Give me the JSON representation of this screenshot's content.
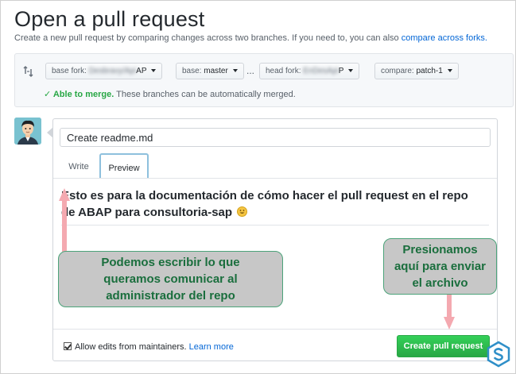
{
  "page": {
    "title": "Open a pull request",
    "subtitle": "Create a new pull request by comparing changes across two branches. If you need to, you can also",
    "compare_forks_link": "compare across forks."
  },
  "compare": {
    "base_fork_prefix": "base fork:",
    "base_fork_hidden": "Desbravy/Api",
    "base_fork_suffix": "AP",
    "base_prefix": "base:",
    "base_value": "master",
    "ellipsis": "...",
    "head_fork_prefix": "head fork:",
    "head_fork_hidden": "EnDesApi",
    "head_fork_suffix": "P",
    "compare_prefix": "compare:",
    "compare_value": "patch-1",
    "merge_status_strong": "✓ Able to merge.",
    "merge_status_text": "These branches can be automatically merged."
  },
  "form": {
    "title_value": "Create readme.md",
    "tab_write": "Write",
    "tab_preview": "Preview",
    "preview_body": "Esto es para la documentación de cómo hacer el pull request en el repo de ABAP para consultoria-sap",
    "allow_edits_label": "Allow edits from maintainers.",
    "learn_more": "Learn more",
    "create_button": "Create pull request"
  },
  "annotations": {
    "left_callout": [
      "Podemos escribir lo que",
      "queramos comunicar al",
      "administrador del repo"
    ],
    "right_callout": [
      "Presionamos",
      "aquí para enviar",
      "el archivo"
    ]
  },
  "colors": {
    "callout_bg": "#c7c7c7",
    "callout_text": "#1a6e3d",
    "arrow": "#f4a9b0",
    "button_green": "#28a745",
    "link": "#0366d6"
  }
}
